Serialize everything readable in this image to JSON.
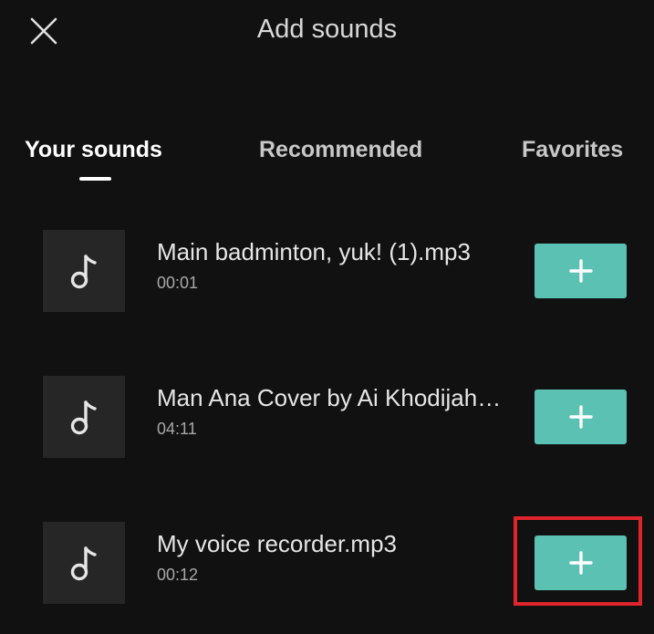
{
  "header": {
    "title": "Add sounds",
    "close_icon": "close-icon"
  },
  "tabs": [
    {
      "label": "Your sounds",
      "active": true
    },
    {
      "label": "Recommended",
      "active": false
    },
    {
      "label": "Favorites",
      "active": false
    }
  ],
  "sounds": [
    {
      "title": "Main badminton, yuk! (1).mp3",
      "duration": "00:01",
      "icon": "music-note-icon",
      "action_icon": "plus-icon"
    },
    {
      "title": "Man Ana Cover by Ai Khodijah…",
      "duration": "04:11",
      "icon": "music-note-icon",
      "action_icon": "plus-icon"
    },
    {
      "title": "My voice recorder.mp3",
      "duration": "00:12",
      "icon": "music-note-icon",
      "action_icon": "plus-icon"
    }
  ],
  "colors": {
    "background": "#111111",
    "thumbnail": "#262626",
    "add_button": "#5bc2b3",
    "highlight": "#e0242c"
  }
}
